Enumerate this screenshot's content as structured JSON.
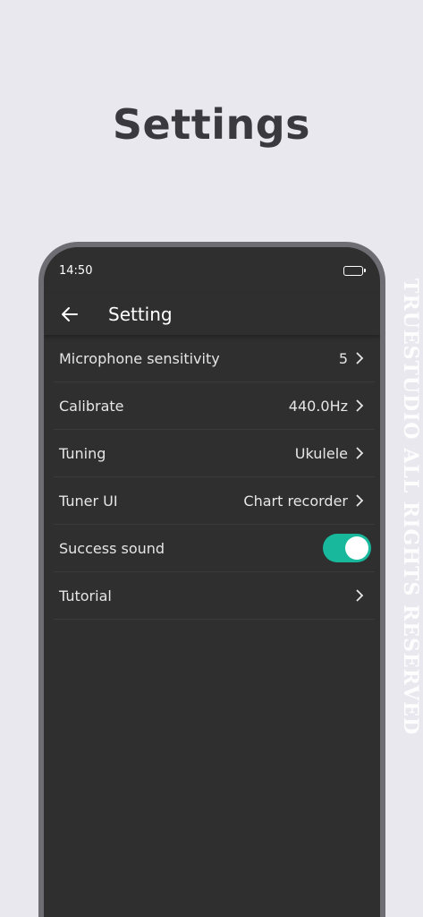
{
  "promo": {
    "title": "Settings"
  },
  "status_bar": {
    "time": "14:50"
  },
  "app_bar": {
    "title": "Setting",
    "back_icon": "arrow-left-icon"
  },
  "settings": [
    {
      "label": "Microphone sensitivity",
      "value": "5"
    },
    {
      "label": "Calibrate",
      "value": "440.0Hz"
    },
    {
      "label": "Tuning",
      "value": "Ukulele"
    },
    {
      "label": "Tuner UI",
      "value": "Chart recorder"
    },
    {
      "label": "Success sound",
      "toggle": true
    },
    {
      "label": "Tutorial",
      "value": ""
    }
  ],
  "watermark": "TRUESTUDIO ALL RIGHTS RESERVED",
  "colors": {
    "accent": "#17b89c",
    "screen_bg": "#2f2f2f",
    "page_bg": "#e9e8ee"
  }
}
